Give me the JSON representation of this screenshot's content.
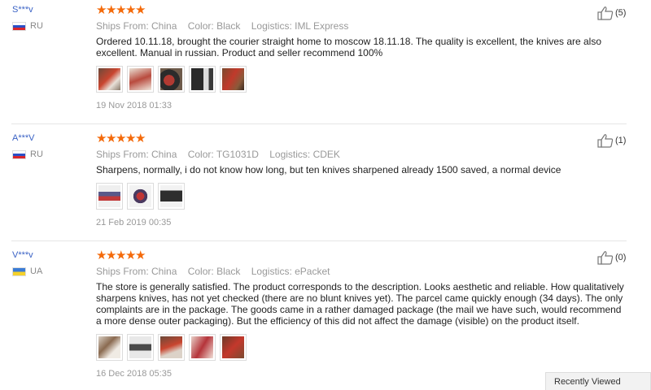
{
  "reviews": [
    {
      "user": "S***v",
      "country": "RU",
      "stars": [
        "★",
        "★",
        "★",
        "★",
        "★"
      ],
      "ships_from": "Ships From: China",
      "color": "Color: Black",
      "logistics": "Logistics: IML Express",
      "text": "Ordered 10.11.18, brought the courier straight home to moscow 18.11.18. The quality is excellent, the knives are also excellent. Manual in russian. Product and seller recommend 100%",
      "helpful_count": "(5)",
      "date": "19 Nov 2018 01:33",
      "photos": [
        "photo-1",
        "photo-2",
        "photo-3",
        "photo-4",
        "photo-5"
      ]
    },
    {
      "user": "A***V",
      "country": "RU",
      "stars": [
        "★",
        "★",
        "★",
        "★",
        "★"
      ],
      "ships_from": "Ships From: China",
      "color": "Color: TG1031D",
      "logistics": "Logistics: CDEK",
      "text": "Sharpens, normally, i do not know how long, but ten knives sharpened already 1500 saved, a normal device",
      "helpful_count": "(1)",
      "date": "21 Feb 2019 00:35",
      "photos": [
        "photo-1",
        "photo-2",
        "photo-3"
      ]
    },
    {
      "user": "V***v",
      "country": "UA",
      "stars": [
        "★",
        "★",
        "★",
        "★",
        "★"
      ],
      "ships_from": "Ships From: China",
      "color": "Color: Black",
      "logistics": "Logistics: ePacket",
      "text": "The store is generally satisfied. The product corresponds to the description. Looks aesthetic and reliable. How qualitatively sharpens knives, has not yet checked (there are no blunt knives yet). The parcel came quickly enough (34 days). The only complaints are in the package. The goods came in a rather damaged package (the mail we have such, would recommend a more dense outer packaging). But the efficiency of this did not affect the damage (visible) on the product itself.",
      "helpful_count": "(0)",
      "date": "16 Dec 2018 05:35",
      "photos": [
        "photo-1",
        "photo-2",
        "photo-3",
        "photo-4",
        "photo-5"
      ]
    }
  ],
  "recently_viewed": "Recently Viewed",
  "colors": {
    "star": "#f46a0a",
    "username": "#3a62c5",
    "meta": "#999999"
  },
  "icons": {
    "helpful": "thumbs-up-icon",
    "rating": "star-icon"
  }
}
